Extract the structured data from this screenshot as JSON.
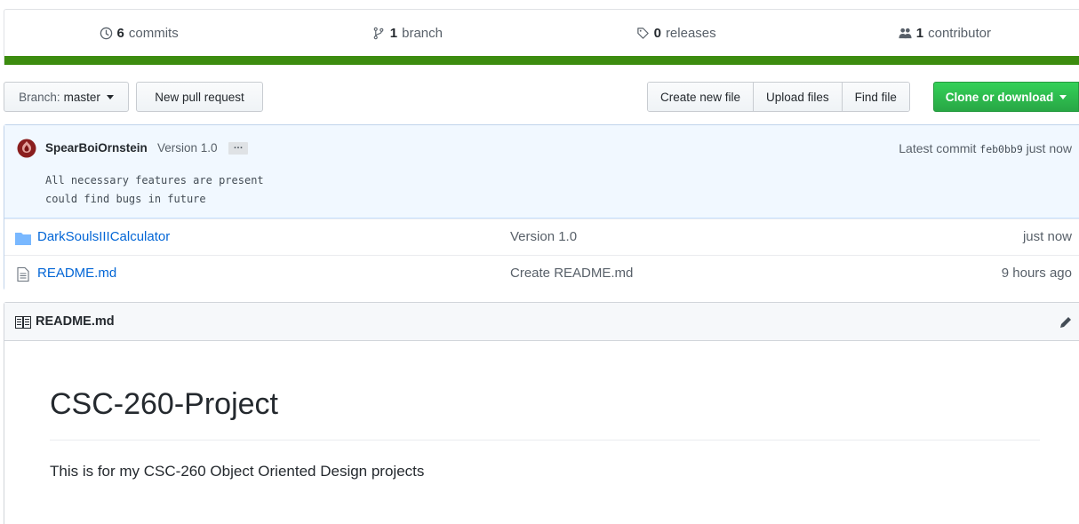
{
  "stats": {
    "commits": {
      "count": "6",
      "label": "commits",
      "icon": "history-icon"
    },
    "branches": {
      "count": "1",
      "label": "branch",
      "icon": "branch-icon"
    },
    "releases": {
      "count": "0",
      "label": "releases",
      "icon": "tag-icon"
    },
    "contributors": {
      "count": "1",
      "label": "contributor",
      "icon": "people-icon"
    },
    "language_bar_color": "#3c8c0f"
  },
  "toolbar": {
    "branch_prefix": "Branch:",
    "branch_name": "master",
    "new_pull_request": "New pull request",
    "create_new_file": "Create new file",
    "upload_files": "Upload files",
    "find_file": "Find file",
    "clone_or_download": "Clone or download"
  },
  "commit": {
    "author": "SpearBoiOrnstein",
    "title": "Version 1.0",
    "ellipsis": "…",
    "description": "All necessary features are present\ncould find bugs in future",
    "latest_label": "Latest commit",
    "sha": "feb0bb9",
    "time": "just now"
  },
  "files": [
    {
      "type": "directory",
      "icon": "folder-icon",
      "name": "DarkSoulsIIICalculator",
      "message": "Version 1.0",
      "age": "just now"
    },
    {
      "type": "file",
      "icon": "file-icon",
      "name": "README.md",
      "message": "Create README.md",
      "age": "9 hours ago"
    }
  ],
  "readme": {
    "header": "README.md",
    "heading": "CSC-260-Project",
    "paragraph": "This is for my CSC-260 Object Oriented Design projects"
  },
  "colors": {
    "link": "#0366d6",
    "green_button": "#28a745",
    "commit_tease_bg": "#f1f8ff"
  }
}
